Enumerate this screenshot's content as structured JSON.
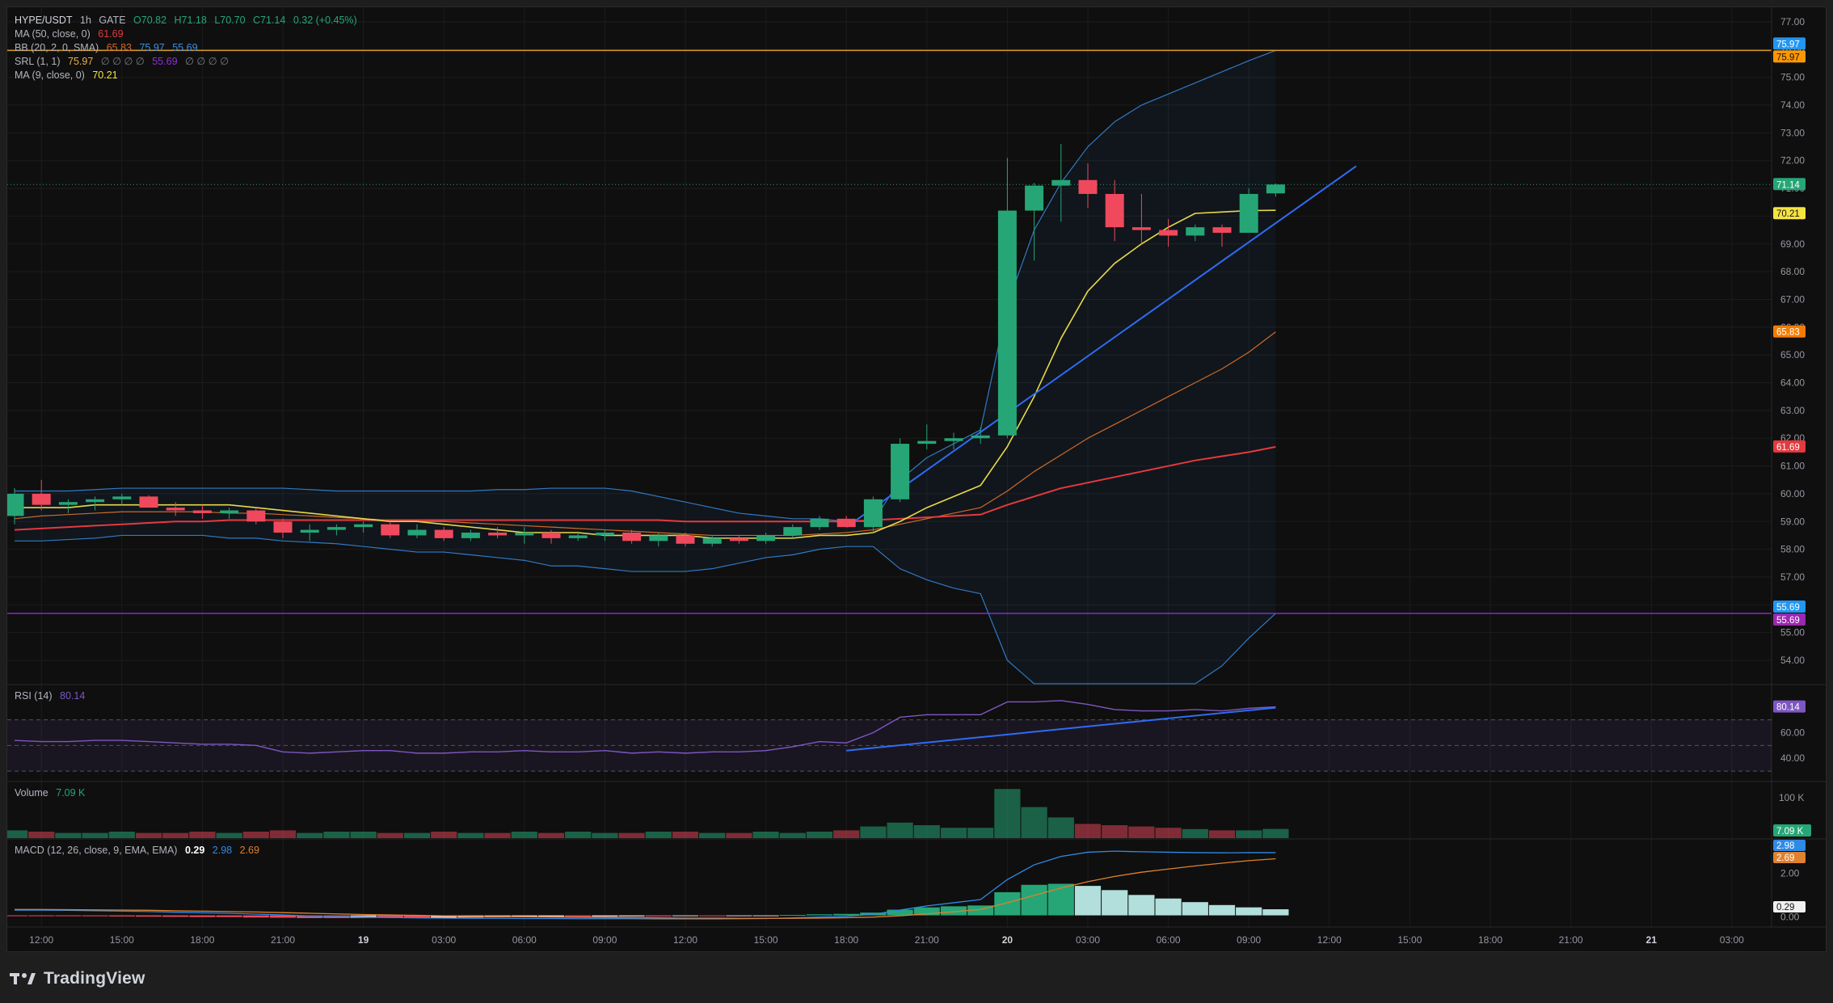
{
  "legend": {
    "symbol": "HYPE/USDT",
    "interval": "1h",
    "exchange": "GATE",
    "open": "O70.82",
    "high": "H71.18",
    "low": "L70.70",
    "close": "C71.14",
    "change": "0.32 (+0.45%)",
    "ma50_label": "MA (50, close, 0)",
    "ma50_value": "61.69",
    "bb_label": "BB (20, 2, 0, SMA)",
    "bb_basis": "65.83",
    "bb_upper": "75.97",
    "bb_lower": "55.69",
    "srl_label": "SRL (1, 1)",
    "srl_value": "75.97",
    "srl_nulls": "∅ ∅ ∅ ∅",
    "srl_value2": "55.69",
    "srl_nulls2": "∅ ∅ ∅ ∅",
    "ma9_label": "MA (9, close, 0)",
    "ma9_value": "70.21"
  },
  "rsi_pane": {
    "label": "RSI (14)",
    "value": "80.14"
  },
  "volume_pane": {
    "label": "Volume",
    "value": "7.09 K"
  },
  "macd_pane": {
    "label": "MACD (12, 26, close, 9, EMA, EMA)",
    "macd": "0.29",
    "signal": "2.98",
    "hist": "2.69"
  },
  "brand": {
    "name": "TradingView"
  },
  "colors": {
    "up": "#26a676",
    "down": "#f0495d",
    "ma50": "#e5393f",
    "ma9": "#e8d94a",
    "bb_band": "#3179c4",
    "bb_basis": "#d0692b",
    "trend": "#2f6cf5",
    "srl_top": "#d79a2a",
    "srl_bottom": "#8e2fd9",
    "rsi": "#7e57c2",
    "macd_line": "#2f8ae6",
    "signal_line": "#e0812d"
  },
  "chart_data": {
    "type": "candlestick",
    "x": [
      "18 11:00",
      "18 12:00",
      "18 13:00",
      "18 14:00",
      "18 15:00",
      "18 16:00",
      "18 17:00",
      "18 18:00",
      "18 19:00",
      "18 20:00",
      "18 21:00",
      "18 22:00",
      "18 23:00",
      "19 00:00",
      "19 01:00",
      "19 02:00",
      "19 03:00",
      "19 04:00",
      "19 05:00",
      "19 06:00",
      "19 07:00",
      "19 08:00",
      "19 09:00",
      "19 10:00",
      "19 11:00",
      "19 12:00",
      "19 13:00",
      "19 14:00",
      "19 15:00",
      "19 16:00",
      "19 17:00",
      "19 18:00",
      "19 19:00",
      "19 20:00",
      "19 21:00",
      "19 22:00",
      "19 23:00",
      "20 00:00",
      "20 01:00",
      "20 02:00",
      "20 03:00",
      "20 04:00",
      "20 05:00",
      "20 06:00",
      "20 07:00",
      "20 08:00",
      "20 09:00",
      "20 10:00"
    ],
    "ohlc": [
      [
        59.2,
        60.2,
        58.9,
        60.0
      ],
      [
        60.0,
        60.5,
        59.4,
        59.6
      ],
      [
        59.6,
        59.8,
        59.3,
        59.7
      ],
      [
        59.7,
        59.9,
        59.4,
        59.8
      ],
      [
        59.8,
        60.0,
        59.6,
        59.9
      ],
      [
        59.9,
        59.95,
        59.5,
        59.5
      ],
      [
        59.5,
        59.7,
        59.2,
        59.4
      ],
      [
        59.4,
        59.6,
        59.1,
        59.3
      ],
      [
        59.3,
        59.5,
        59.1,
        59.4
      ],
      [
        59.4,
        59.5,
        58.9,
        59.0
      ],
      [
        59.0,
        59.1,
        58.4,
        58.6
      ],
      [
        58.6,
        58.9,
        58.3,
        58.7
      ],
      [
        58.7,
        58.9,
        58.5,
        58.8
      ],
      [
        58.8,
        59.0,
        58.6,
        58.9
      ],
      [
        58.9,
        59.0,
        58.4,
        58.5
      ],
      [
        58.5,
        58.9,
        58.4,
        58.7
      ],
      [
        58.7,
        58.8,
        58.3,
        58.4
      ],
      [
        58.4,
        58.7,
        58.3,
        58.6
      ],
      [
        58.6,
        58.8,
        58.4,
        58.5
      ],
      [
        58.5,
        58.8,
        58.2,
        58.6
      ],
      [
        58.6,
        58.7,
        58.2,
        58.4
      ],
      [
        58.4,
        58.6,
        58.3,
        58.5
      ],
      [
        58.5,
        58.7,
        58.3,
        58.6
      ],
      [
        58.6,
        58.7,
        58.2,
        58.3
      ],
      [
        58.3,
        58.6,
        58.1,
        58.5
      ],
      [
        58.5,
        58.6,
        58.1,
        58.2
      ],
      [
        58.2,
        58.5,
        58.1,
        58.4
      ],
      [
        58.4,
        58.5,
        58.2,
        58.3
      ],
      [
        58.3,
        58.6,
        58.2,
        58.5
      ],
      [
        58.5,
        58.9,
        58.4,
        58.8
      ],
      [
        58.8,
        59.2,
        58.7,
        59.1
      ],
      [
        59.1,
        59.2,
        58.8,
        58.8
      ],
      [
        58.8,
        59.9,
        58.6,
        59.8
      ],
      [
        59.8,
        62.0,
        59.7,
        61.8
      ],
      [
        61.8,
        62.5,
        61.6,
        61.9
      ],
      [
        61.9,
        62.2,
        61.6,
        62.0
      ],
      [
        62.0,
        62.4,
        61.8,
        62.1
      ],
      [
        62.1,
        72.1,
        62.0,
        70.2
      ],
      [
        70.2,
        71.2,
        68.4,
        71.1
      ],
      [
        71.1,
        72.6,
        69.8,
        71.3
      ],
      [
        71.3,
        71.9,
        70.3,
        70.8
      ],
      [
        70.8,
        71.3,
        69.1,
        69.6
      ],
      [
        69.6,
        70.8,
        69.0,
        69.5
      ],
      [
        69.5,
        69.9,
        68.9,
        69.3
      ],
      [
        69.3,
        69.7,
        69.1,
        69.6
      ],
      [
        69.6,
        69.7,
        68.9,
        69.4
      ],
      [
        69.4,
        71.0,
        69.4,
        70.8
      ],
      [
        70.82,
        71.18,
        70.7,
        71.14
      ]
    ],
    "ma9": [
      59.5,
      59.5,
      59.5,
      59.6,
      59.6,
      59.6,
      59.6,
      59.6,
      59.6,
      59.5,
      59.4,
      59.3,
      59.2,
      59.1,
      59.0,
      59.0,
      58.9,
      58.8,
      58.7,
      58.6,
      58.6,
      58.6,
      58.5,
      58.5,
      58.5,
      58.5,
      58.4,
      58.4,
      58.4,
      58.4,
      58.5,
      58.5,
      58.6,
      59.0,
      59.5,
      59.9,
      60.3,
      61.7,
      63.5,
      65.6,
      67.3,
      68.3,
      69.0,
      69.6,
      70.1,
      70.15,
      70.2,
      70.21
    ],
    "ma50": [
      58.7,
      58.75,
      58.8,
      58.85,
      58.9,
      58.95,
      59.0,
      59.0,
      59.05,
      59.05,
      59.05,
      59.05,
      59.05,
      59.05,
      59.05,
      59.05,
      59.05,
      59.05,
      59.05,
      59.05,
      59.05,
      59.05,
      59.05,
      59.05,
      59.05,
      59.0,
      59.0,
      59.0,
      59.0,
      59.0,
      59.0,
      59.0,
      59.05,
      59.1,
      59.15,
      59.2,
      59.25,
      59.6,
      59.9,
      60.2,
      60.4,
      60.6,
      60.8,
      61.0,
      61.2,
      61.35,
      61.5,
      61.69
    ],
    "bb_upper": [
      60.1,
      60.1,
      60.1,
      60.15,
      60.2,
      60.2,
      60.2,
      60.2,
      60.2,
      60.2,
      60.2,
      60.15,
      60.1,
      60.1,
      60.1,
      60.1,
      60.1,
      60.1,
      60.15,
      60.15,
      60.2,
      60.2,
      60.2,
      60.1,
      59.9,
      59.7,
      59.5,
      59.3,
      59.2,
      59.1,
      59.1,
      59.0,
      59.0,
      60.5,
      61.3,
      61.8,
      62.3,
      66.8,
      69.5,
      71.2,
      72.5,
      73.4,
      74.0,
      74.4,
      74.8,
      75.2,
      75.6,
      75.97
    ],
    "bb_basis": [
      59.1,
      59.2,
      59.25,
      59.3,
      59.35,
      59.35,
      59.35,
      59.35,
      59.3,
      59.3,
      59.25,
      59.2,
      59.15,
      59.1,
      59.05,
      59.0,
      59.0,
      58.95,
      58.9,
      58.85,
      58.8,
      58.75,
      58.7,
      58.65,
      58.6,
      58.55,
      58.5,
      58.5,
      58.5,
      58.5,
      58.55,
      58.6,
      58.7,
      58.9,
      59.1,
      59.3,
      59.5,
      60.1,
      60.8,
      61.4,
      62.0,
      62.5,
      63.0,
      63.5,
      64.0,
      64.5,
      65.1,
      65.83
    ],
    "bb_lower": [
      58.3,
      58.3,
      58.35,
      58.4,
      58.5,
      58.5,
      58.5,
      58.5,
      58.4,
      58.4,
      58.3,
      58.25,
      58.2,
      58.1,
      58.0,
      57.9,
      57.9,
      57.8,
      57.7,
      57.6,
      57.4,
      57.4,
      57.3,
      57.2,
      57.2,
      57.2,
      57.3,
      57.5,
      57.7,
      57.8,
      58.0,
      58.1,
      58.1,
      57.3,
      56.9,
      56.6,
      56.4,
      54.0,
      52.5,
      51.5,
      50.8,
      50.5,
      50.6,
      51.3,
      52.5,
      53.8,
      54.8,
      55.69
    ],
    "trend_line": {
      "x_start": "19 18:00",
      "y_start": 58.8,
      "x_end": "20 13:00",
      "y_end": 71.8
    },
    "srl_levels": [
      75.97,
      55.69
    ],
    "last_price": 71.14,
    "price_axis": {
      "min": 53.5,
      "max": 77.0,
      "ticks": [
        "54.00",
        "55.00",
        "56.00",
        "57.00",
        "58.00",
        "59.00",
        "60.00",
        "61.00",
        "62.00",
        "63.00",
        "64.00",
        "65.00",
        "66.00",
        "67.00",
        "68.00",
        "69.00",
        "70.00",
        "71.00",
        "72.00",
        "73.00",
        "74.00",
        "75.00",
        "76.00",
        "77.00"
      ]
    },
    "price_labels": [
      {
        "value": "75.97",
        "color": "#2196f3"
      },
      {
        "value": "75.97",
        "color": "#ff9800"
      },
      {
        "value": "71.14",
        "color": "#26a676"
      },
      {
        "value": "70.21",
        "color": "#f5e342"
      },
      {
        "value": "65.83",
        "color": "#f57c00"
      },
      {
        "value": "61.69",
        "color": "#e5393f"
      },
      {
        "value": "55.69",
        "color": "#2196f3"
      },
      {
        "value": "55.69",
        "color": "#9c27b0"
      }
    ],
    "time_axis": [
      "12:00",
      "15:00",
      "18:00",
      "21:00",
      "19",
      "03:00",
      "06:00",
      "09:00",
      "12:00",
      "15:00",
      "18:00",
      "21:00",
      "20",
      "03:00",
      "06:00",
      "09:00",
      "12:00",
      "15:00",
      "18:00",
      "21:00",
      "21",
      "03:00"
    ],
    "rsi": [
      54,
      53,
      53,
      54,
      54,
      53,
      52,
      51,
      51,
      50,
      45,
      44,
      45,
      46,
      46,
      44,
      44,
      45,
      45,
      46,
      45,
      45,
      46,
      44,
      45,
      44,
      45,
      45,
      46,
      49,
      53,
      52,
      60,
      72,
      74,
      74,
      74,
      84,
      84,
      85,
      82,
      78,
      77,
      77,
      78,
      77,
      79,
      80.14
    ],
    "rsi_ticks": [
      "40.00",
      "60.00",
      "80.14"
    ],
    "volume": [
      6,
      5,
      4,
      4,
      5,
      4,
      4,
      5,
      4,
      5,
      6,
      4,
      5,
      5,
      4,
      4,
      5,
      4,
      4,
      5,
      4,
      5,
      4,
      4,
      5,
      5,
      4,
      4,
      5,
      4,
      5,
      6,
      9,
      12,
      10,
      8,
      8,
      38,
      24,
      16,
      11,
      10,
      9,
      8,
      7,
      6,
      6,
      7.09
    ],
    "volume_ticks": [
      "100 K",
      "7.09 K"
    ],
    "macd_line": [
      0.25,
      0.25,
      0.24,
      0.22,
      0.2,
      0.18,
      0.15,
      0.12,
      0.1,
      0.06,
      0.02,
      -0.03,
      -0.06,
      -0.08,
      -0.1,
      -0.12,
      -0.13,
      -0.14,
      -0.14,
      -0.15,
      -0.15,
      -0.16,
      -0.16,
      -0.16,
      -0.17,
      -0.17,
      -0.17,
      -0.16,
      -0.15,
      -0.12,
      -0.08,
      -0.04,
      0.05,
      0.25,
      0.45,
      0.6,
      0.75,
      1.7,
      2.4,
      2.8,
      3.0,
      3.05,
      3.02,
      3.0,
      2.98,
      2.97,
      2.98,
      2.98
    ],
    "signal_line": [
      0.28,
      0.28,
      0.27,
      0.26,
      0.25,
      0.24,
      0.22,
      0.2,
      0.18,
      0.16,
      0.13,
      0.1,
      0.07,
      0.04,
      0.02,
      0.0,
      -0.02,
      -0.04,
      -0.05,
      -0.07,
      -0.08,
      -0.09,
      -0.1,
      -0.11,
      -0.12,
      -0.13,
      -0.13,
      -0.14,
      -0.14,
      -0.14,
      -0.13,
      -0.11,
      -0.08,
      -0.02,
      0.07,
      0.17,
      0.28,
      0.6,
      0.95,
      1.3,
      1.6,
      1.85,
      2.05,
      2.2,
      2.35,
      2.48,
      2.6,
      2.69
    ],
    "macd_hist": [
      -0.03,
      -0.03,
      -0.03,
      -0.04,
      -0.05,
      -0.06,
      -0.07,
      -0.08,
      -0.08,
      -0.1,
      -0.11,
      -0.13,
      -0.13,
      -0.12,
      -0.12,
      -0.12,
      -0.11,
      -0.1,
      -0.09,
      -0.08,
      -0.07,
      -0.07,
      -0.06,
      -0.05,
      -0.05,
      -0.04,
      -0.04,
      -0.02,
      -0.01,
      0.02,
      0.05,
      0.07,
      0.13,
      0.27,
      0.38,
      0.43,
      0.47,
      1.1,
      1.45,
      1.5,
      1.4,
      1.2,
      0.97,
      0.8,
      0.63,
      0.49,
      0.38,
      0.29
    ],
    "macd_ticks": [
      "2.98",
      "2.69",
      "2.00",
      "0.29",
      "0.00"
    ]
  }
}
